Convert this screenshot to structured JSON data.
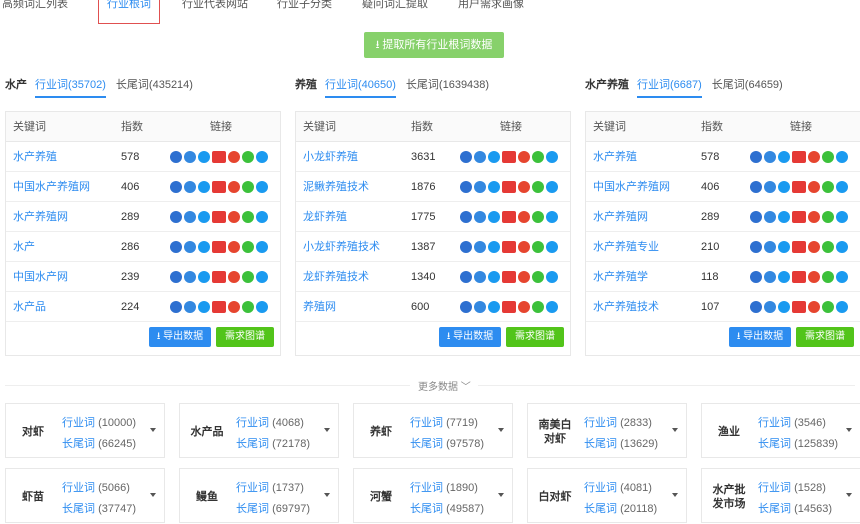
{
  "top_tabs": [
    "高频词汇列表",
    "行业根词",
    "行业代表网站",
    "行业子分类",
    "疑问词汇提取",
    "用户需求画像"
  ],
  "extract_button": "提取所有行业根词数据",
  "headers": {
    "keyword": "关键词",
    "index": "指数",
    "links": "链接"
  },
  "icons": [
    "baidu-icon",
    "360-icon",
    "sogou-icon",
    "shenma-icon",
    "weibo-icon",
    "wechat-icon",
    "zhihu-icon"
  ],
  "panels": [
    {
      "name": "水产",
      "tab1": "行业词(35702)",
      "tab2": "长尾词(435214)",
      "rows": [
        {
          "kw": "水产养殖",
          "idx": "578"
        },
        {
          "kw": "中国水产养殖网",
          "idx": "406"
        },
        {
          "kw": "水产养殖网",
          "idx": "289"
        },
        {
          "kw": "水产",
          "idx": "286"
        },
        {
          "kw": "中国水产网",
          "idx": "239"
        },
        {
          "kw": "水产品",
          "idx": "224"
        }
      ],
      "export": "导出数据",
      "chart": "需求图谱"
    },
    {
      "name": "养殖",
      "tab1": "行业词(40650)",
      "tab2": "长尾词(1639438)",
      "rows": [
        {
          "kw": "小龙虾养殖",
          "idx": "3631"
        },
        {
          "kw": "泥鳅养殖技术",
          "idx": "1876"
        },
        {
          "kw": "龙虾养殖",
          "idx": "1775"
        },
        {
          "kw": "小龙虾养殖技术",
          "idx": "1387"
        },
        {
          "kw": "龙虾养殖技术",
          "idx": "1340"
        },
        {
          "kw": "养殖网",
          "idx": "600"
        }
      ],
      "export": "导出数据",
      "chart": "需求图谱"
    },
    {
      "name": "水产养殖",
      "tab1": "行业词(6687)",
      "tab2": "长尾词(64659)",
      "rows": [
        {
          "kw": "水产养殖",
          "idx": "578"
        },
        {
          "kw": "中国水产养殖网",
          "idx": "406"
        },
        {
          "kw": "水产养殖网",
          "idx": "289"
        },
        {
          "kw": "水产养殖专业",
          "idx": "210"
        },
        {
          "kw": "水产养殖学",
          "idx": "118"
        },
        {
          "kw": "水产养殖技术",
          "idx": "107"
        }
      ],
      "export": "导出数据",
      "chart": "需求图谱"
    }
  ],
  "more_data": "更多数据",
  "cards": [
    {
      "name": "对虾",
      "l1": "行业词",
      "n1": "(10000)",
      "l2": "长尾词",
      "n2": "(66245)"
    },
    {
      "name": "水产品",
      "l1": "行业词",
      "n1": "(4068)",
      "l2": "长尾词",
      "n2": "(72178)"
    },
    {
      "name": "养虾",
      "l1": "行业词",
      "n1": "(7719)",
      "l2": "长尾词",
      "n2": "(97578)"
    },
    {
      "name": "南美白对虾",
      "l1": "行业词",
      "n1": "(2833)",
      "l2": "长尾词",
      "n2": "(13629)"
    },
    {
      "name": "渔业",
      "l1": "行业词",
      "n1": "(3546)",
      "l2": "长尾词",
      "n2": "(125839)"
    },
    {
      "name": "虾苗",
      "l1": "行业词",
      "n1": "(5066)",
      "l2": "长尾词",
      "n2": "(37747)"
    },
    {
      "name": "鳗鱼",
      "l1": "行业词",
      "n1": "(1737)",
      "l2": "长尾词",
      "n2": "(69797)"
    },
    {
      "name": "河蟹",
      "l1": "行业词",
      "n1": "(1890)",
      "l2": "长尾词",
      "n2": "(49587)"
    },
    {
      "name": "白对虾",
      "l1": "行业词",
      "n1": "(4081)",
      "l2": "长尾词",
      "n2": "(20118)"
    },
    {
      "name": "水产批发市场",
      "l1": "行业词",
      "n1": "(1528)",
      "l2": "长尾词",
      "n2": "(14563)"
    }
  ]
}
